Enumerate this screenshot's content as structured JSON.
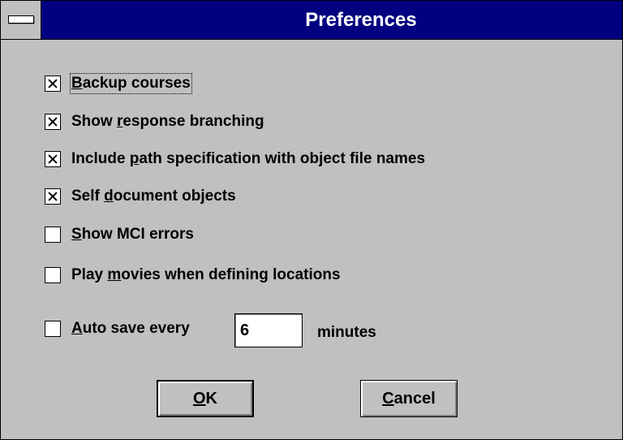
{
  "window": {
    "title": "Preferences"
  },
  "options": [
    {
      "pre": "",
      "key": "B",
      "post": "ackup courses",
      "checked": true
    },
    {
      "pre": "Show ",
      "key": "r",
      "post": "esponse branching",
      "checked": true
    },
    {
      "pre": "Include ",
      "key": "p",
      "post": "ath specification with object file names",
      "checked": true
    },
    {
      "pre": "Self ",
      "key": "d",
      "post": "ocument objects",
      "checked": true
    },
    {
      "pre": "",
      "key": "S",
      "post": "how MCI errors",
      "checked": false
    },
    {
      "pre": "Play ",
      "key": "m",
      "post": "ovies when defining locations",
      "checked": false
    }
  ],
  "autosave": {
    "pre": "",
    "key": "A",
    "post": "uto save every",
    "checked": false,
    "value": "6",
    "unit_label": "minutes"
  },
  "buttons": {
    "ok": {
      "pre": "",
      "key": "O",
      "post": "K"
    },
    "cancel": {
      "pre": "",
      "key": "C",
      "post": "ancel"
    }
  },
  "icons": {
    "system_menu": "system-menu-icon",
    "checkbox_checked": "x-mark"
  },
  "colors": {
    "title_bar": "#000080",
    "title_text": "#ffffff",
    "dialog_face": "#c0c0c0"
  }
}
